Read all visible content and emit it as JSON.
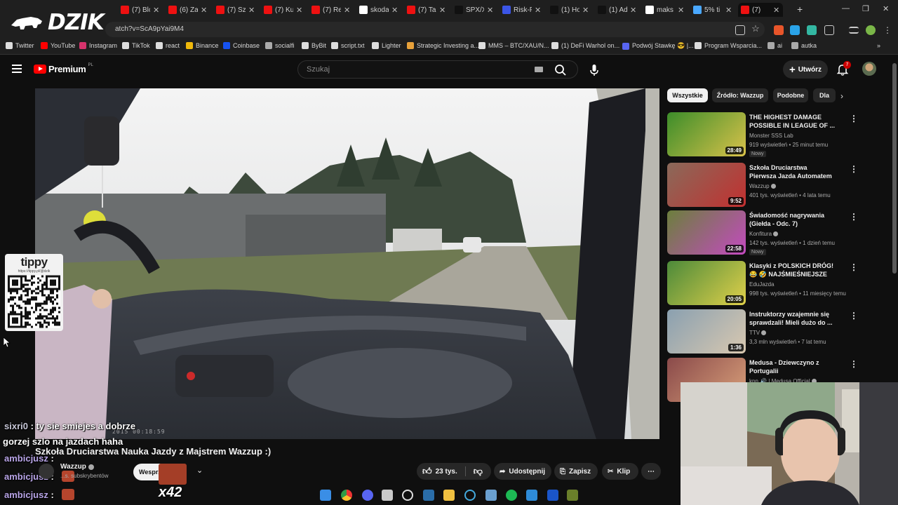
{
  "browser": {
    "tabs": [
      {
        "label": "(7) Blo",
        "fav": "#e11"
      },
      {
        "label": "(6) Za",
        "fav": "#e11"
      },
      {
        "label": "(7) Sz",
        "fav": "#e11"
      },
      {
        "label": "(7) Ku",
        "fav": "#e11"
      },
      {
        "label": "(7) Re",
        "fav": "#e11"
      },
      {
        "label": "skoda",
        "fav": "#fff"
      },
      {
        "label": "(7) Ta",
        "fav": "#e11"
      },
      {
        "label": "SPX/X",
        "fav": "#111"
      },
      {
        "label": "Risk-F",
        "fav": "#3b55e6"
      },
      {
        "label": "(1) Ho",
        "fav": "#111"
      },
      {
        "label": "(1) Ad",
        "fav": "#111"
      },
      {
        "label": "maks",
        "fav": "#fff"
      },
      {
        "label": "5% ti",
        "fav": "#4aa8ff"
      },
      {
        "label": "(7) ",
        "fav": "#e11"
      }
    ],
    "url": "atch?v=ScA9pYai9M4",
    "bookmarks": [
      {
        "label": "Twitter",
        "color": "#ddd"
      },
      {
        "label": "YouTube",
        "color": "#f00"
      },
      {
        "label": "Instagram",
        "color": "#d6336c"
      },
      {
        "label": "TikTok",
        "color": "#ddd"
      },
      {
        "label": "react",
        "color": "#ddd"
      },
      {
        "label": "Binance",
        "color": "#f0b90b"
      },
      {
        "label": "Coinbase",
        "color": "#1652f0"
      },
      {
        "label": "socialfi",
        "color": "#aaa"
      },
      {
        "label": "ByBit",
        "color": "#ddd"
      },
      {
        "label": "script.txt",
        "color": "#ddd"
      },
      {
        "label": "Lighter",
        "color": "#ddd"
      },
      {
        "label": "Strategic Investing a...",
        "color": "#e8a13a"
      },
      {
        "label": "MMS – BTC/XAU/N...",
        "color": "#ddd"
      },
      {
        "label": "(1) DeFi Warhol on...",
        "color": "#ddd"
      },
      {
        "label": "Podwój Stawkę 😎 |...",
        "color": "#5865f2"
      },
      {
        "label": "Program Wsparcia...",
        "color": "#ddd"
      },
      {
        "label": "ai",
        "color": "#aaa"
      },
      {
        "label": "autka",
        "color": "#aaa"
      }
    ]
  },
  "overlay": {
    "logo_text": "DZIK",
    "tippy_title": "tippy",
    "tippy_url": "https://tippy.pl/@dzik",
    "timestamp": "2015 00:18:59",
    "chat": [
      {
        "user": "sixri0",
        "text": " : ty sie smiejes a dobrze"
      },
      {
        "user": "",
        "text": "gorzej szlo na jazdach haha"
      },
      {
        "user": "ambicjusz",
        "text": " :"
      },
      {
        "user": "ambicjusz",
        "text": " :"
      },
      {
        "user": "ambicjusz",
        "text": " :"
      }
    ],
    "multiplier": "x42"
  },
  "youtube": {
    "brand": "Premium",
    "brand_suffix": "PL",
    "search_placeholder": "Szukaj",
    "create_label": "Utwórz",
    "notifications": "7",
    "video": {
      "title": "Szkoła Druciarstwa Nauka Jazdy z Majstrem Wazzup :)",
      "channel": "Wazzup",
      "subscribers": "...s. subskrybentów",
      "join_label": "Wesprzyj",
      "likes": "23 tys.",
      "share": "Udostępnij",
      "save": "Zapisz",
      "clip": "Klip"
    },
    "chips": [
      "Wszystkie",
      "Źródło: Wazzup",
      "Podobne",
      "Dla"
    ],
    "recommendations": [
      {
        "title": "THE HIGHEST DAMAGE POSSIBLE IN LEAGUE OF ...",
        "channel": "Monster SSS Lab",
        "verified": false,
        "meta": "919 wyświetleń • 25 minut temu",
        "badge": "Nowy",
        "duration": "28:49",
        "c1": "#3c8d2a",
        "c2": "#d9c24a"
      },
      {
        "title": "Szkoła Druciarstwa Pierwsza Jazda Automatem Majster ...",
        "channel": "Wazzup",
        "verified": true,
        "meta": "401 tys. wyświetleń • 4 lata temu",
        "badge": "",
        "duration": "9:52",
        "c1": "#8a6a5a",
        "c2": "#c23030"
      },
      {
        "title": "Świadomość nagrywania (Giełda - Odc. 7)",
        "channel": "Konfitura",
        "verified": true,
        "meta": "142 tys. wyświetleń • 1 dzień temu",
        "badge": "Nowy",
        "duration": "22:58",
        "c1": "#6b7f3c",
        "c2": "#c44ac0"
      },
      {
        "title": "Klasyki z POLSKICH DRÓG! 😂 🤣 NAJŚMIEŚNIEJSZE Wpadk...",
        "channel": "EduJazda",
        "verified": false,
        "meta": "998 tys. wyświetleń • 11 miesięcy temu",
        "badge": "",
        "duration": "20:05",
        "c1": "#4c8a3a",
        "c2": "#e0d04a"
      },
      {
        "title": "Instruktorzy wzajemnie się sprawdzali! Mieli dużo do ...",
        "channel": "TTV",
        "verified": true,
        "meta": "3,3 mln wyświetleń • 7 lat temu",
        "badge": "",
        "duration": "1:36",
        "c1": "#8aa0b0",
        "c2": "#d8c8b0"
      },
      {
        "title": "Medusa - Dziewczyno z Portugalii",
        "channel": "kpn 🔊 | Medusa Official",
        "verified": true,
        "meta": "",
        "badge": "",
        "duration": "",
        "c1": "#8a4a4a",
        "c2": "#d9a07a"
      }
    ]
  }
}
